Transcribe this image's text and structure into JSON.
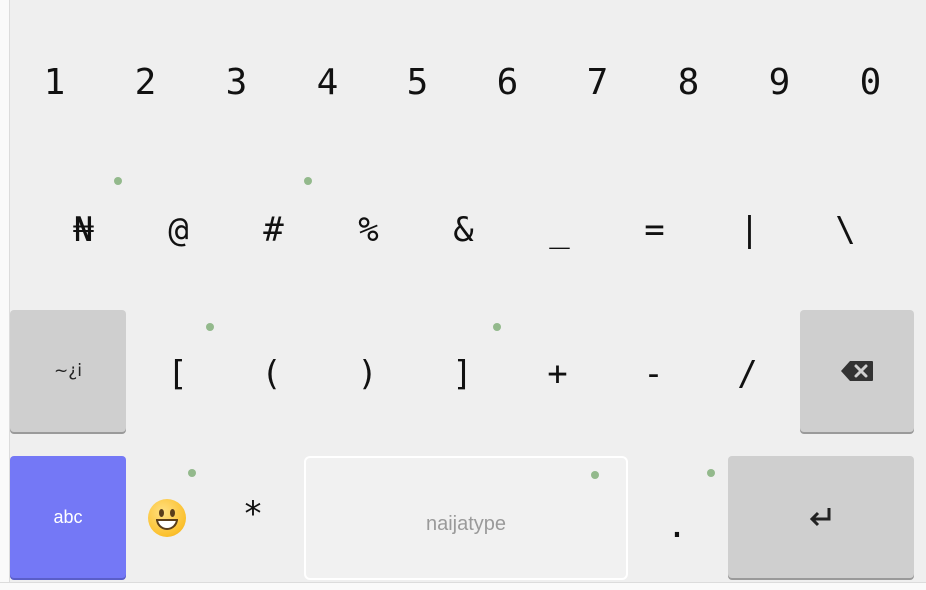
{
  "keyboard": {
    "row1": [
      "1",
      "2",
      "3",
      "4",
      "5",
      "6",
      "7",
      "8",
      "9",
      "0"
    ],
    "row2": [
      "₦",
      "@",
      "#",
      "%",
      "&",
      "_",
      "=",
      "|",
      "\\"
    ],
    "row3": {
      "shift_label": "~¿i",
      "keys": [
        "[",
        "(",
        ")",
        "]",
        "+",
        "-",
        "/"
      ],
      "backspace_icon": "backspace-icon"
    },
    "row4": {
      "abc_label": "abc",
      "emoji_icon": "grinning-face-icon",
      "star": "*",
      "space_label": "naijatype",
      "period": ".",
      "enter_icon": "enter-icon"
    },
    "colors": {
      "background": "#efefef",
      "special_key": "#cfcfcf",
      "abc_key": "#7478f6",
      "hint_dot": "#93b98c"
    }
  }
}
